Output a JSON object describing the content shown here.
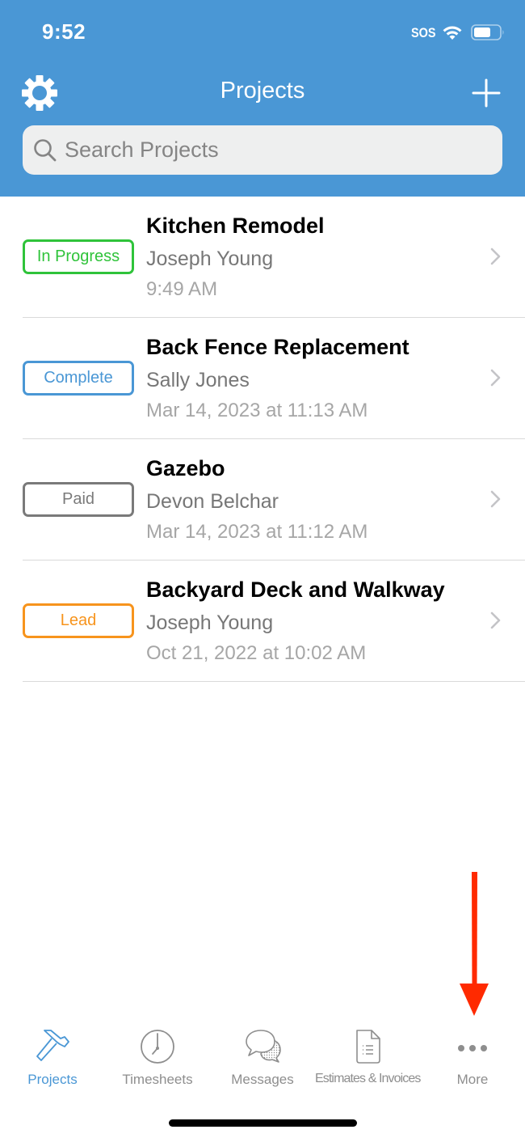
{
  "status_bar": {
    "time": "9:52",
    "carrier": "SOS",
    "icons": [
      "wifi-icon",
      "battery-icon"
    ]
  },
  "header": {
    "title": "Projects",
    "left_icon": "gear-icon",
    "right_icon": "plus-icon",
    "background_color": "#4a97d5"
  },
  "search": {
    "placeholder": "Search Projects",
    "value": "",
    "icon": "search-icon"
  },
  "projects": [
    {
      "status": "In Progress",
      "status_color": "#2fc33a",
      "title": "Kitchen Remodel",
      "client": "Joseph Young",
      "date": "9:49 AM"
    },
    {
      "status": "Complete",
      "status_color": "#4a97d5",
      "title": "Back Fence Replacement",
      "client": "Sally Jones",
      "date": "Mar 14, 2023 at 11:13 AM"
    },
    {
      "status": "Paid",
      "status_color": "#7a7a7a",
      "title": "Gazebo",
      "client": "Devon Belchar",
      "date": "Mar 14, 2023 at 11:12 AM"
    },
    {
      "status": "Lead",
      "status_color": "#f7941d",
      "title": "Backyard Deck and Walkway",
      "client": "Joseph Young",
      "date": "Oct 21, 2022 at 10:02 AM"
    }
  ],
  "annotation": {
    "type": "arrow-down",
    "color": "#ff2a00",
    "points_to": "More"
  },
  "tab_bar": {
    "active_color": "#4a97d5",
    "inactive_color": "#8e8e8e",
    "tabs": [
      {
        "label": "Projects",
        "icon": "hammer-icon",
        "active": true
      },
      {
        "label": "Timesheets",
        "icon": "clock-icon",
        "active": false
      },
      {
        "label": "Messages",
        "icon": "chat-bubbles-icon",
        "active": false
      },
      {
        "label": "Estimates & Invoices",
        "icon": "document-list-icon",
        "active": false
      },
      {
        "label": "More",
        "icon": "more-dots-icon",
        "active": false
      }
    ]
  }
}
